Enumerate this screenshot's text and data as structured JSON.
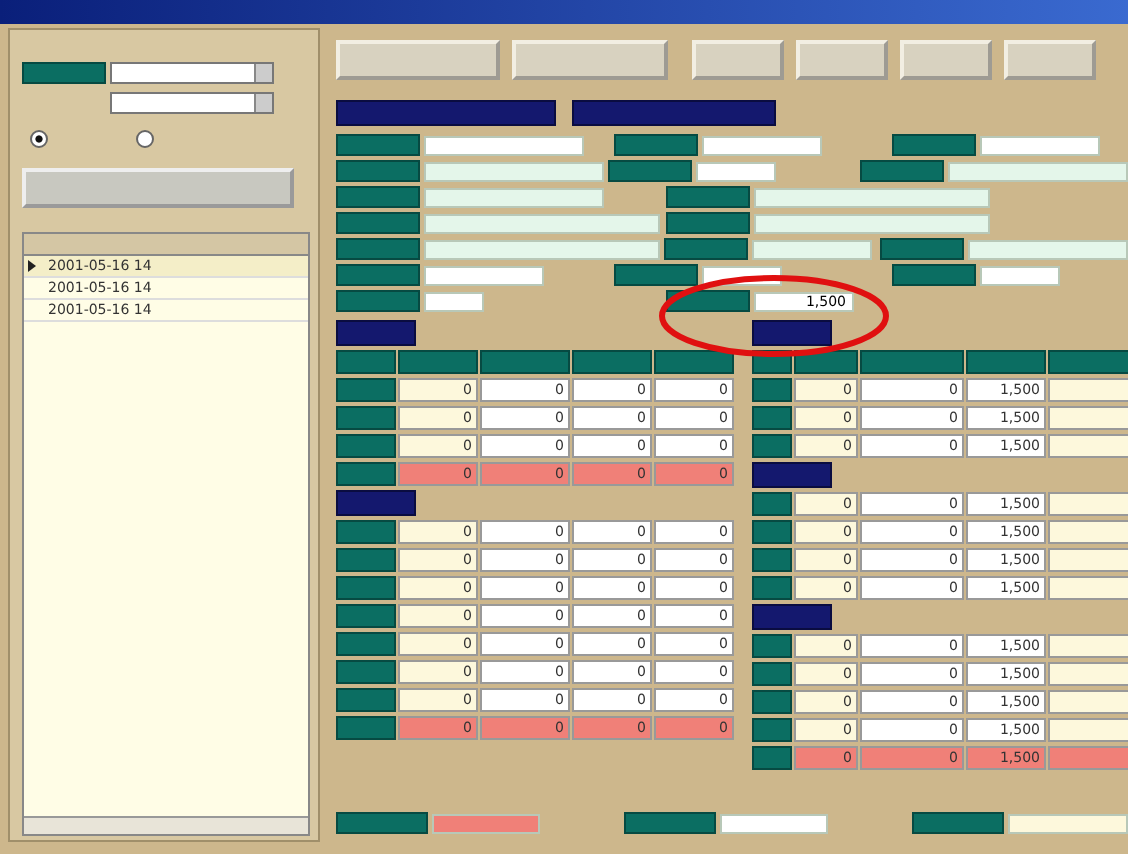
{
  "list": {
    "rows": [
      {
        "date": "2001-05-16 14",
        "selected": true
      },
      {
        "date": "2001-05-16 14",
        "selected": false
      },
      {
        "date": "2001-05-16 14",
        "selected": false
      }
    ]
  },
  "left_grids": [
    {
      "rows": [
        {
          "kind": "row",
          "cells": [
            "0",
            "0",
            "0",
            "0"
          ]
        },
        {
          "kind": "row",
          "cells": [
            "0",
            "0",
            "0",
            "0"
          ]
        },
        {
          "kind": "row",
          "cells": [
            "0",
            "0",
            "0",
            "0"
          ]
        },
        {
          "kind": "total",
          "cells": [
            "0",
            "0",
            "0",
            "0"
          ]
        }
      ]
    },
    {
      "rows": [
        {
          "kind": "row",
          "cells": [
            "0",
            "0",
            "0",
            "0"
          ]
        },
        {
          "kind": "row",
          "cells": [
            "0",
            "0",
            "0",
            "0"
          ]
        },
        {
          "kind": "row",
          "cells": [
            "0",
            "0",
            "0",
            "0"
          ]
        },
        {
          "kind": "row",
          "cells": [
            "0",
            "0",
            "0",
            "0"
          ]
        },
        {
          "kind": "row",
          "cells": [
            "0",
            "0",
            "0",
            "0"
          ]
        },
        {
          "kind": "row",
          "cells": [
            "0",
            "0",
            "0",
            "0"
          ]
        },
        {
          "kind": "row",
          "cells": [
            "0",
            "0",
            "0",
            "0"
          ]
        },
        {
          "kind": "total",
          "cells": [
            "0",
            "0",
            "0",
            "0"
          ]
        }
      ]
    }
  ],
  "right_grids": [
    {
      "rows": [
        {
          "kind": "row",
          "cells": [
            "0",
            "0",
            "1,500"
          ]
        },
        {
          "kind": "row",
          "cells": [
            "0",
            "0",
            "1,500"
          ]
        },
        {
          "kind": "row",
          "cells": [
            "0",
            "0",
            "1,500"
          ]
        }
      ]
    },
    {
      "rows": [
        {
          "kind": "row",
          "cells": [
            "0",
            "0",
            "1,500"
          ]
        },
        {
          "kind": "row",
          "cells": [
            "0",
            "0",
            "1,500"
          ]
        },
        {
          "kind": "row",
          "cells": [
            "0",
            "0",
            "1,500"
          ]
        },
        {
          "kind": "row",
          "cells": [
            "0",
            "0",
            "1,500"
          ]
        }
      ]
    },
    {
      "rows": [
        {
          "kind": "row",
          "cells": [
            "0",
            "0",
            "1,500"
          ]
        },
        {
          "kind": "row",
          "cells": [
            "0",
            "0",
            "1,500"
          ]
        },
        {
          "kind": "row",
          "cells": [
            "0",
            "0",
            "1,500"
          ]
        },
        {
          "kind": "row",
          "cells": [
            "0",
            "0",
            "1,500"
          ]
        },
        {
          "kind": "total",
          "cells": [
            "0",
            "0",
            "1,500"
          ]
        }
      ]
    }
  ],
  "highlight": {
    "value": "1,500"
  },
  "radios": [
    {
      "checked": true
    },
    {
      "checked": false
    }
  ]
}
